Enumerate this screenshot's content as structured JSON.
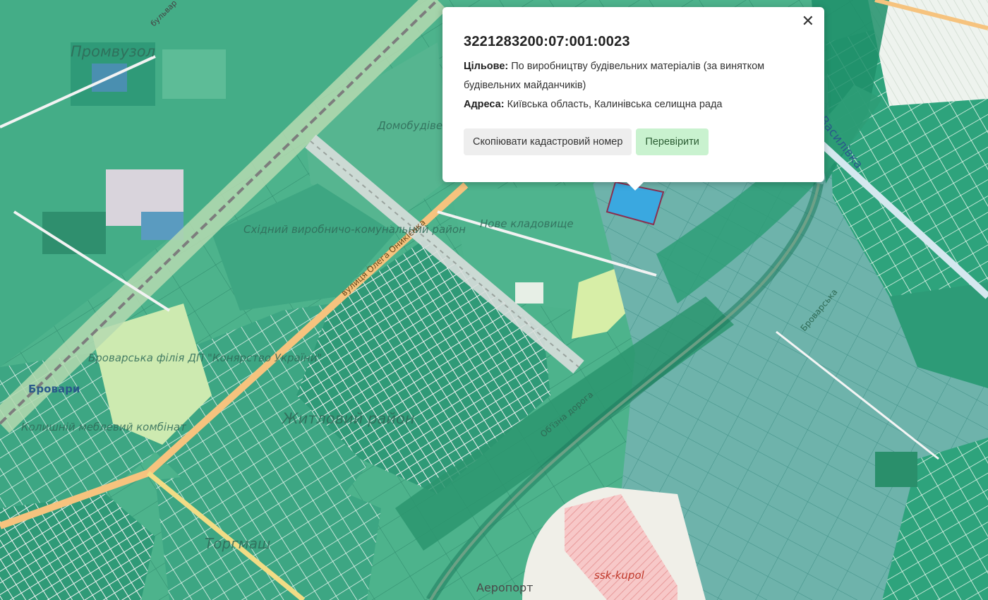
{
  "map": {
    "labels": {
      "promvuzol": "Промвузол",
      "domobud": "Домобудівельний комбінат «Меркурій»",
      "nove_kladovyshche": "Нове кладовище",
      "skhidnyi": "Східний виробничо-комунальний район",
      "brovarska_filiia": "Броварська філія ДП \"Конярство України\"",
      "brovary": "Бровари",
      "kolyshnii": "Колишній меблевий комбінат",
      "zhytlovyi": "Житловий район",
      "torgmash": "Торгмаш",
      "aeroport": "Аеропорт",
      "ssk_kupol": "ssk-kupol",
      "vasylivka": "Василівка",
      "obiizna": "Об'їзна дорога",
      "brovarska": "Броварська",
      "vul_olega": "вулиця Олега Оникієнка",
      "bulvar": "бульвар"
    },
    "colors": {
      "parcel_dark": "#2e9e78",
      "parcel_mid": "#4fb38e",
      "parcel_light": "#7cc9a6",
      "parcel_blue": "#5aa8a8",
      "highlight": "#3aa8e0",
      "road_main": "#f3c27a",
      "rail": "#8a8a8a"
    }
  },
  "popup": {
    "cadastral_number": "3221283200:07:001:0023",
    "purpose_label": "Цільове:",
    "purpose_value": "По виробництву будівельних матеріалів (за винятком будівельних майданчиків)",
    "address_label": "Адреса:",
    "address_value": "Київська область, Калинівська селищна рада",
    "copy_button": "Скопіювати кадастровий номер",
    "check_button": "Перевірити",
    "close_glyph": "✕"
  }
}
